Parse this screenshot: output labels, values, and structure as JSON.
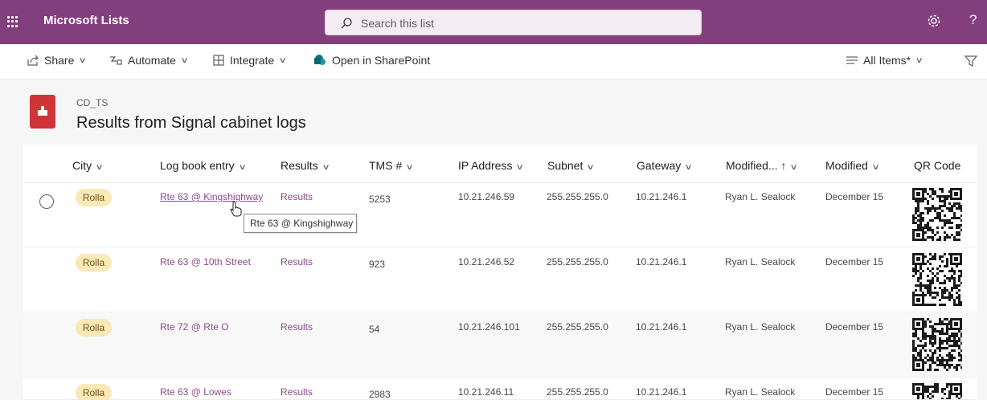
{
  "app": {
    "title": "Microsoft Lists"
  },
  "search": {
    "placeholder": "Search this list"
  },
  "help": {
    "label": "?"
  },
  "commands": {
    "share": "Share",
    "automate": "Automate",
    "integrate": "Integrate",
    "open_sharepoint": "Open in SharePoint",
    "view": "All Items*"
  },
  "list": {
    "subtitle": "CD_TS",
    "title": "Results from Signal cabinet logs"
  },
  "columns": [
    "City",
    "Log book entry",
    "Results",
    "TMS #",
    "IP Address",
    "Subnet",
    "Gateway",
    "Modified... ↑",
    "Modified",
    "QR Code"
  ],
  "rows": [
    {
      "city": "Rolla",
      "log": "Rte 63 @ Kingshighway",
      "results": "Results",
      "tms": "5253",
      "ip": "10.21.246.59",
      "subnet": "255.255.255.0",
      "gateway": "10.21.246.1",
      "modified_by": "Ryan L. Sealock",
      "modified": "December 15"
    },
    {
      "city": "Rolla",
      "log": "Rte 63 @ 10th Street",
      "results": "Results",
      "tms": "923",
      "ip": "10.21.246.52",
      "subnet": "255.255.255.0",
      "gateway": "10.21.246.1",
      "modified_by": "Ryan L. Sealock",
      "modified": "December 15"
    },
    {
      "city": "Rolla",
      "log": "Rte 72 @ Rte O",
      "results": "Results",
      "tms": "54",
      "ip": "10.21.246.101",
      "subnet": "255.255.255.0",
      "gateway": "10.21.246.1",
      "modified_by": "Ryan L. Sealock",
      "modified": "December 15"
    },
    {
      "city": "Rolla",
      "log": "Rte 63 @ Lowes",
      "results": "Results",
      "tms": "2983",
      "ip": "10.21.246.11",
      "subnet": "255.255.255.0",
      "gateway": "10.21.246.1",
      "modified_by": "Ryan L. Sealock",
      "modified": "December 15"
    }
  ],
  "tooltip": {
    "text": "Rte 63 @ Kingshighway"
  },
  "colors": {
    "brand": "#833f7d",
    "link": "#8a4a85",
    "pill": "#fae8b7",
    "list_icon": "#d13438"
  },
  "icons": [
    "waffle-icon",
    "search-icon",
    "gear-icon",
    "share-icon",
    "automate-icon",
    "integrate-icon",
    "sharepoint-icon",
    "filter-icon",
    "view-icon",
    "qr-code-icon"
  ]
}
